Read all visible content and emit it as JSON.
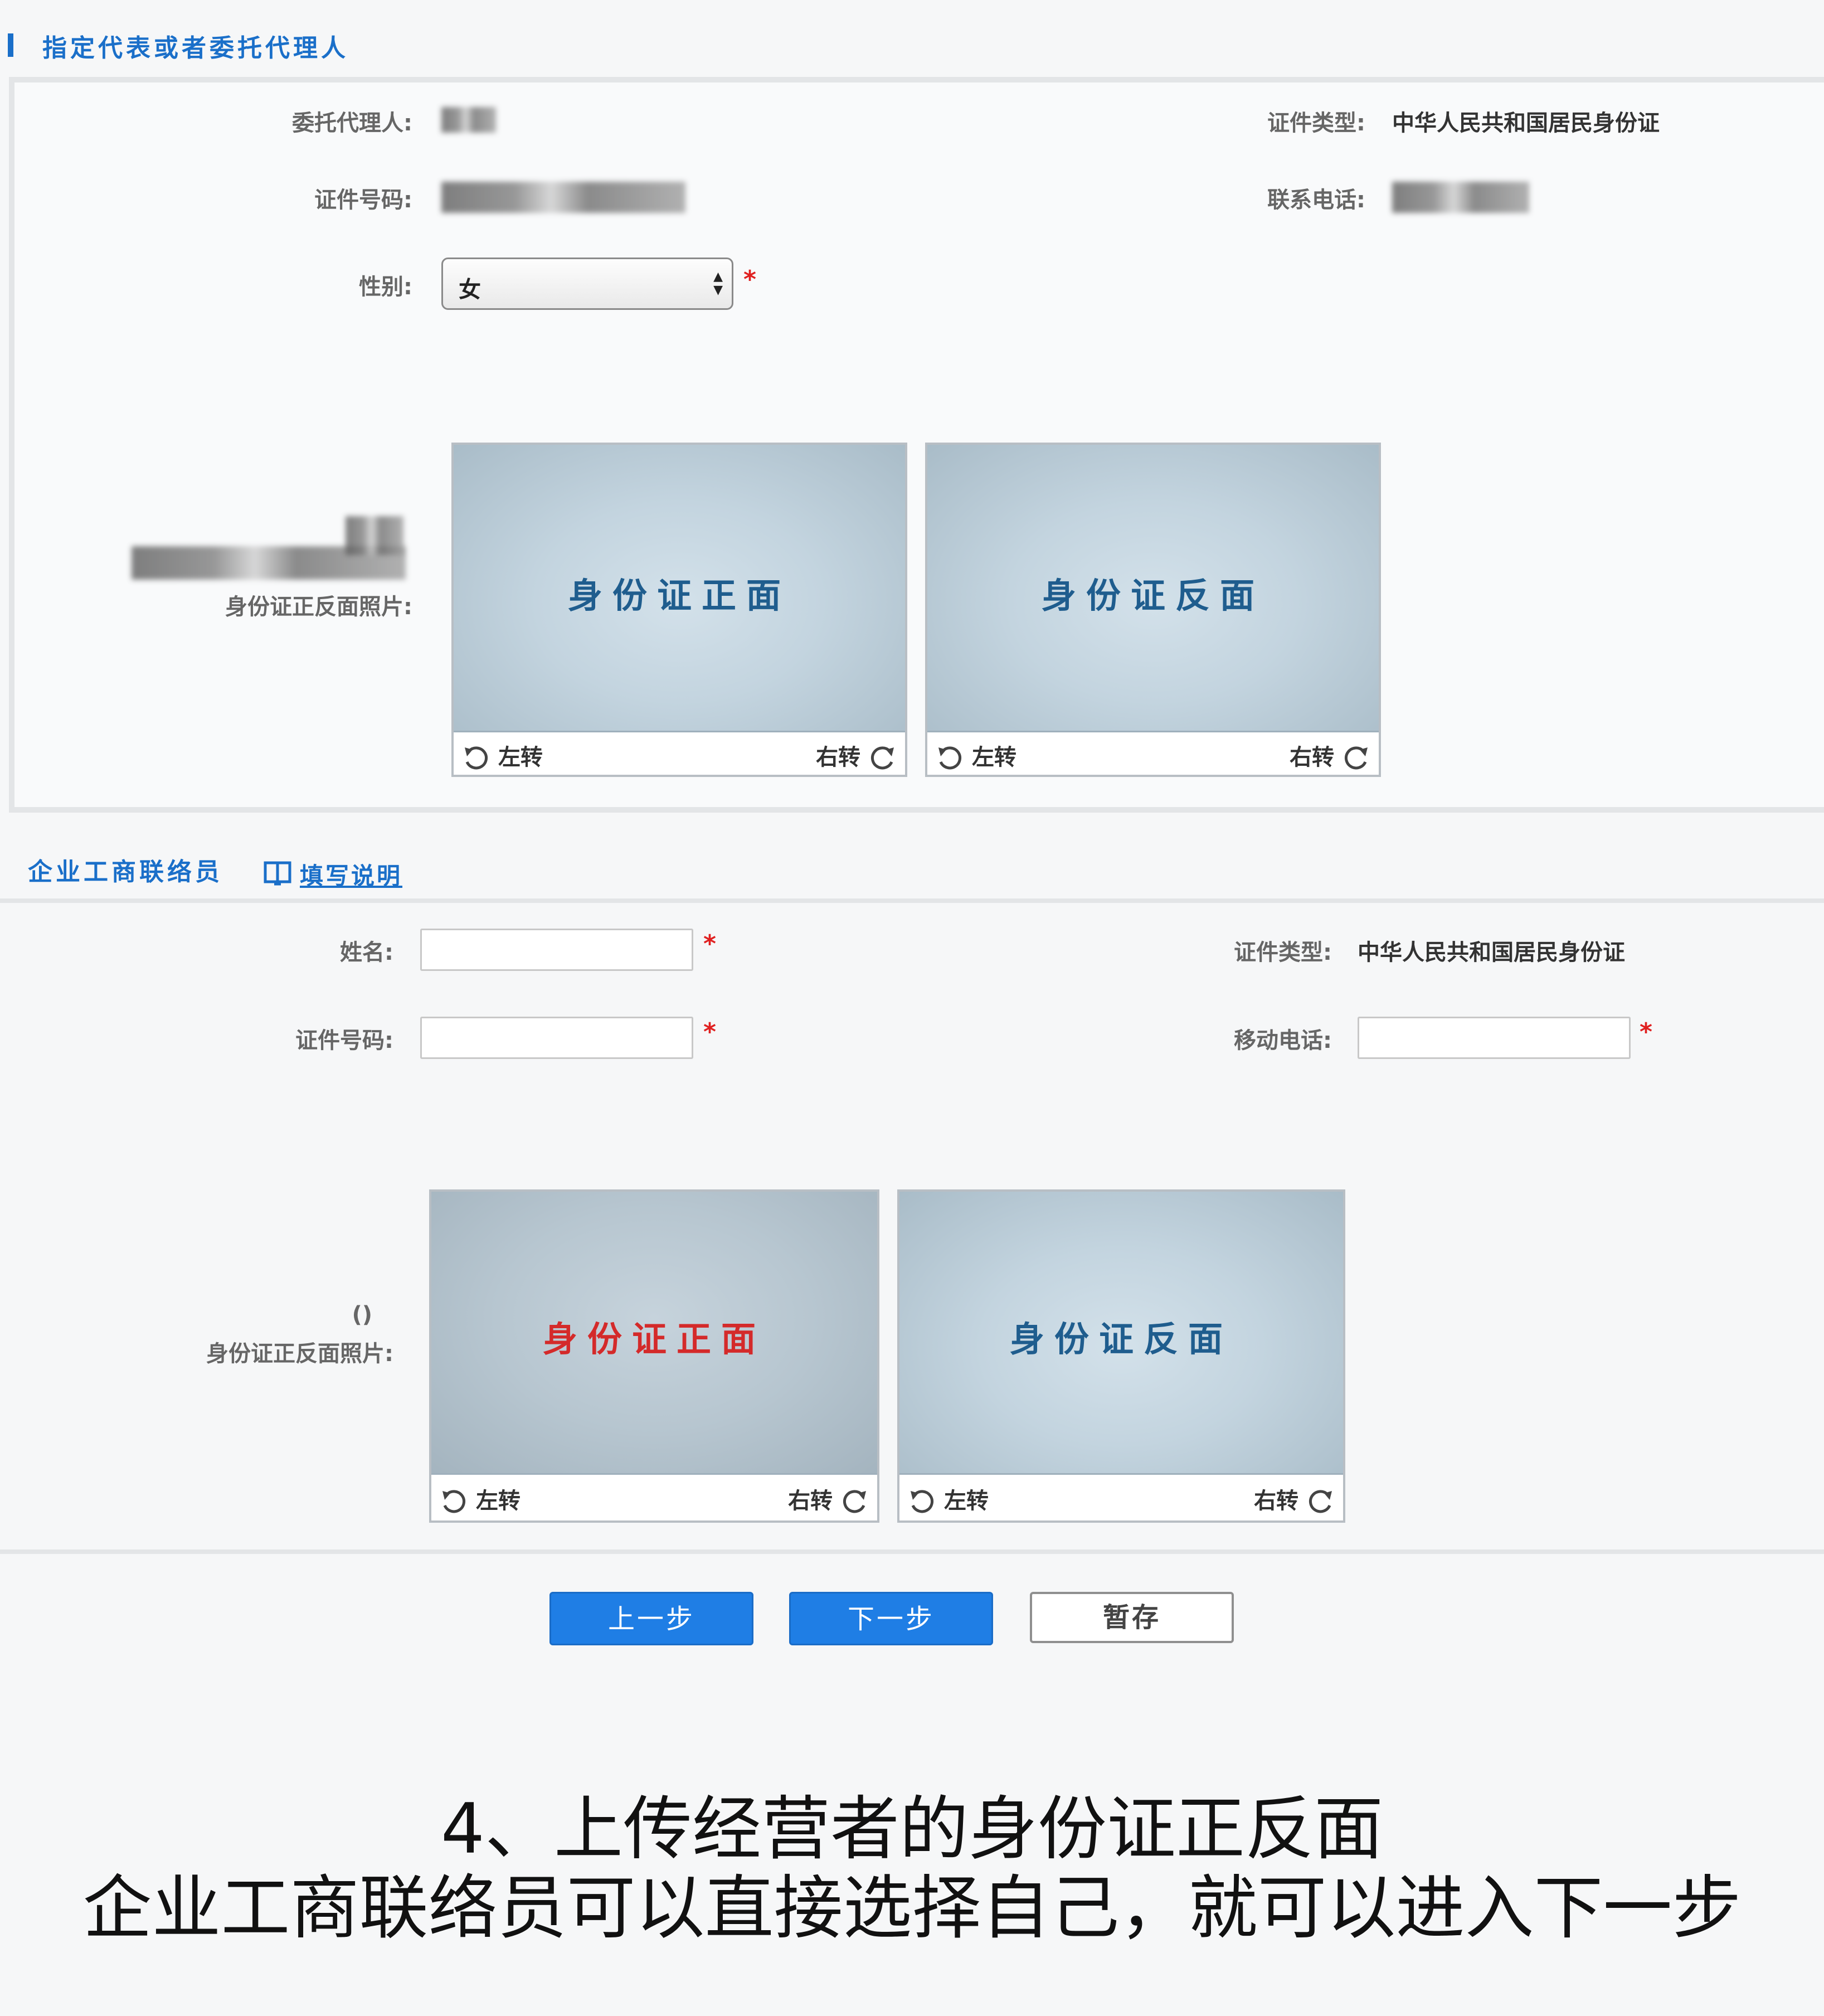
{
  "section1": {
    "title": "指定代表或者委托代理人",
    "agent_label": "委托代理人:",
    "doc_type_label": "证件类型:",
    "doc_type_value": "中华人民共和国居民身份证",
    "id_number_label": "证件号码:",
    "phone_label": "联系电话:",
    "gender_label": "性别:",
    "gender_value": "女",
    "photo_label": "身份证正反面照片:",
    "card_front": "身份证正面",
    "card_back": "身份证反面",
    "rotate_left": "左转",
    "rotate_right": "右转"
  },
  "section2": {
    "title": "企业工商联络员",
    "guide_link": "填写说明",
    "name_label": "姓名:",
    "doc_type_label": "证件类型:",
    "doc_type_value": "中华人民共和国居民身份证",
    "id_number_label": "证件号码:",
    "mobile_label": "移动电话:",
    "photo_paren": "()",
    "photo_label": "身份证正反面照片:",
    "card_front": "身份证正面",
    "card_back": "身份证反面",
    "rotate_left": "左转",
    "rotate_right": "右转"
  },
  "required_mark": "*",
  "buttons": {
    "prev": "上一步",
    "next": "下一步",
    "save": "暂存"
  },
  "caption": {
    "line1": "4、上传经营者的身份证正反面",
    "line2": "企业工商联络员可以直接选择自己，就可以进入下一步"
  },
  "colors": {
    "accent": "#1a6fc9",
    "required": "#e02020",
    "button_primary": "#1f7ee5",
    "card_front_highlight": "#d42a2a"
  }
}
